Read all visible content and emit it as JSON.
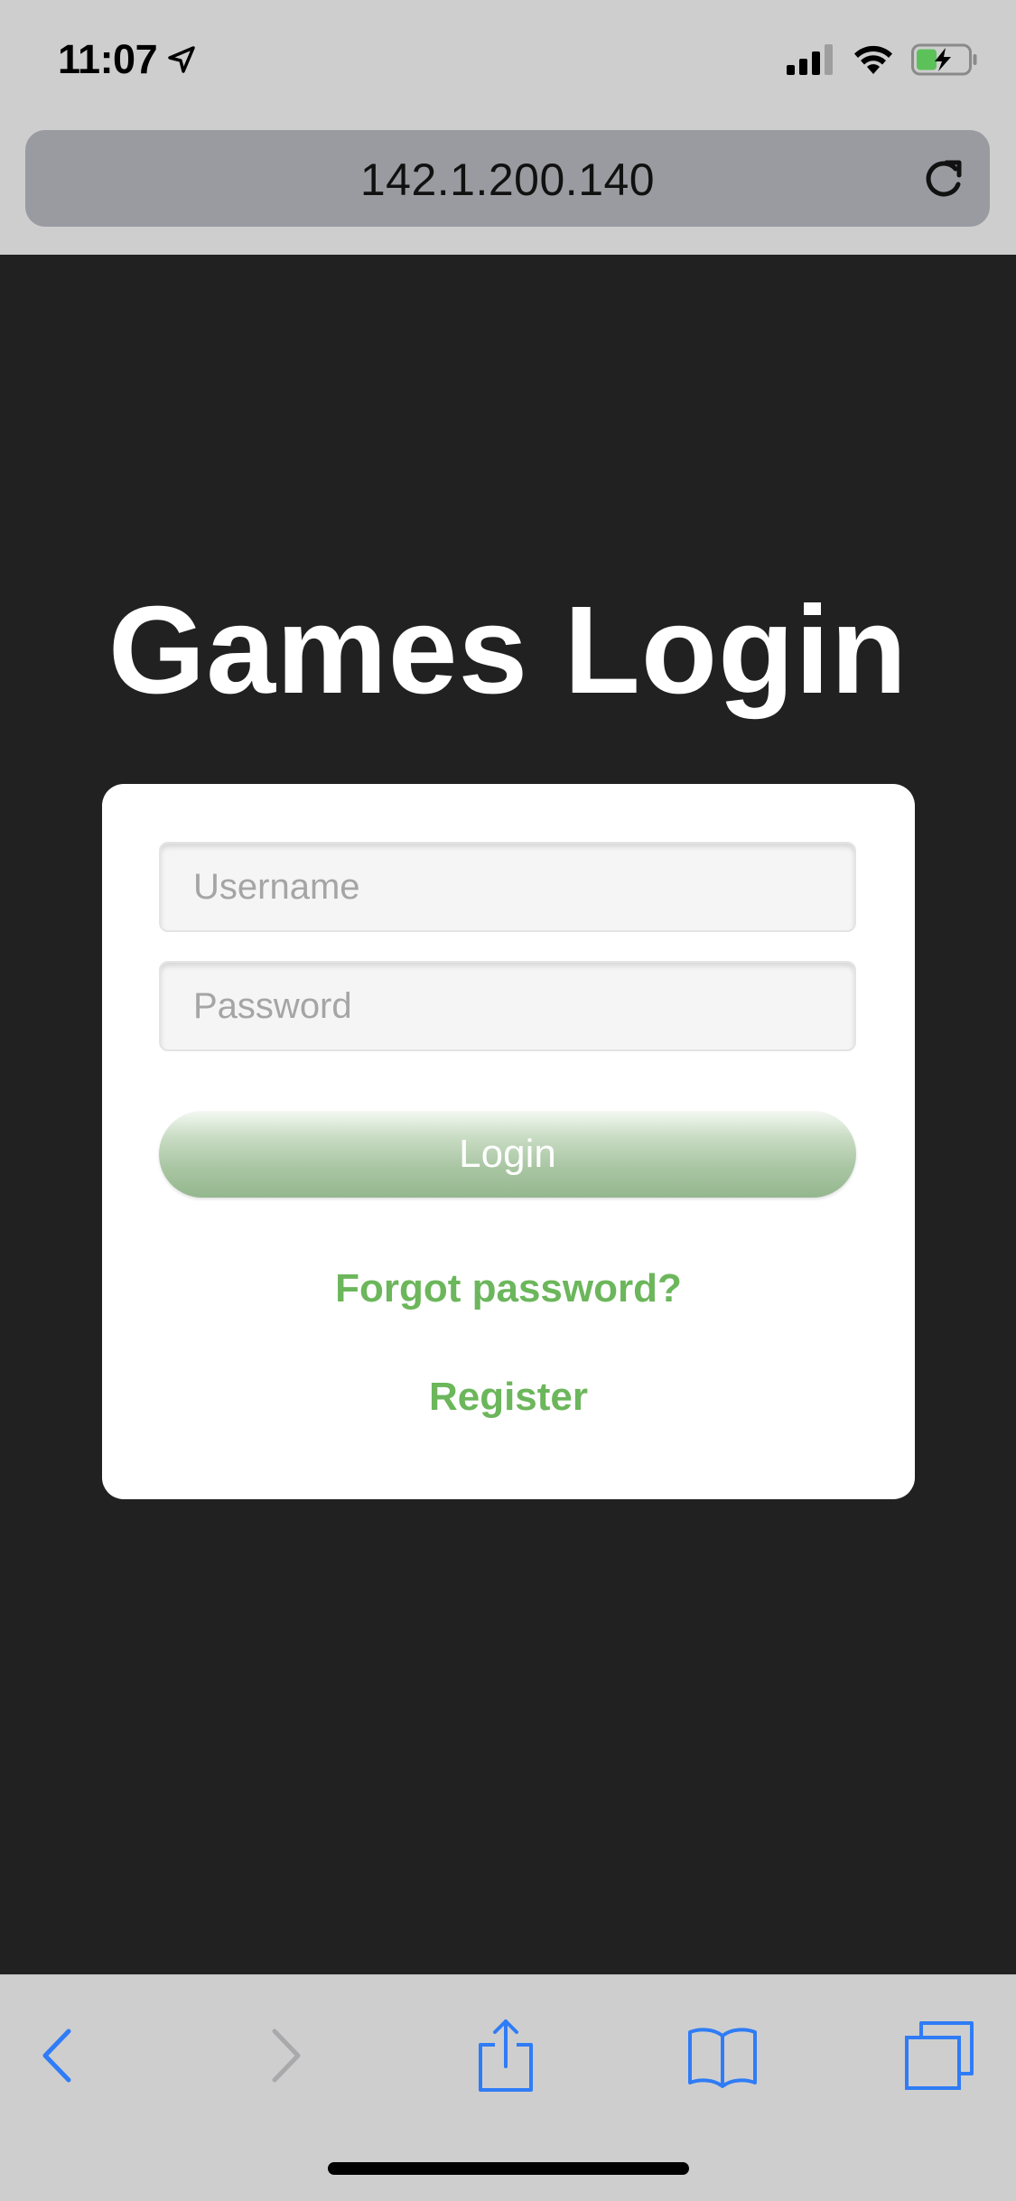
{
  "status_bar": {
    "time": "11:07",
    "icons": [
      "location-arrow-icon",
      "cellular-signal-icon",
      "wifi-icon",
      "battery-charging-icon"
    ]
  },
  "browser": {
    "url": "142.1.200.140",
    "reload_icon": "reload-icon"
  },
  "page": {
    "title": "Games Login",
    "username_placeholder": "Username",
    "password_placeholder": "Password",
    "login_label": "Login",
    "forgot_label": "Forgot password?",
    "register_label": "Register"
  },
  "toolbar": {
    "items": [
      "back-icon",
      "forward-icon",
      "share-icon",
      "bookmarks-icon",
      "tabs-icon"
    ]
  },
  "colors": {
    "page_background": "#212121",
    "chrome_background": "#cececf",
    "link_green": "#6cb65b",
    "ios_blue": "#2f7cf6",
    "button_gradient_bottom": "#94b78e"
  }
}
